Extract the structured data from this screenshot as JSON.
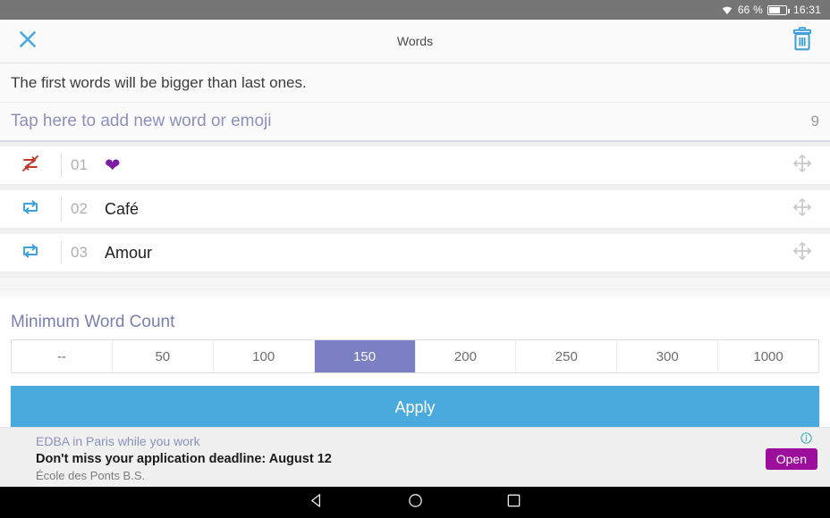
{
  "statusbar": {
    "wifi_icon": "wifi-icon",
    "battery_percent": "66 %",
    "battery_icon": "battery-icon",
    "time": "16:31"
  },
  "appbar": {
    "close_icon": "close-icon",
    "title": "Words",
    "delete_icon": "trash-icon"
  },
  "hint": {
    "text": "The first words will be bigger than last ones."
  },
  "add_word": {
    "placeholder": "Tap here to add new word or emoji",
    "counter": "9"
  },
  "words": [
    {
      "index": "01",
      "text": "❤",
      "repeat_icon": "repeat-off-icon",
      "repeat_state": "off",
      "drag_icon": "move-icon"
    },
    {
      "index": "02",
      "text": "Café",
      "repeat_icon": "repeat-icon",
      "repeat_state": "on",
      "drag_icon": "move-icon"
    },
    {
      "index": "03",
      "text": "Amour",
      "repeat_icon": "repeat-icon",
      "repeat_state": "on",
      "drag_icon": "move-icon"
    }
  ],
  "min_word_count": {
    "title": "Minimum Word Count",
    "options": [
      "--",
      "50",
      "100",
      "150",
      "200",
      "250",
      "300",
      "1000"
    ],
    "selected": "150",
    "selected_index": 3
  },
  "apply": {
    "label": "Apply"
  },
  "ad": {
    "headline": "EDBA in Paris while you work",
    "body": "Don't miss your application deadline: August 12",
    "source": "École des Ponts B.S.",
    "button_label": "Open",
    "info_icon": "info-icon"
  },
  "navbar": {
    "back_icon": "back-icon",
    "home_icon": "home-icon",
    "recents_icon": "recents-icon"
  },
  "colors": {
    "accent_blue": "#4aa9dd",
    "accent_purple": "#7b7fc4",
    "repeat_off_red": "#c0392b",
    "ad_open_purple": "#9c0f9c",
    "statusbar_gray": "#757575"
  }
}
